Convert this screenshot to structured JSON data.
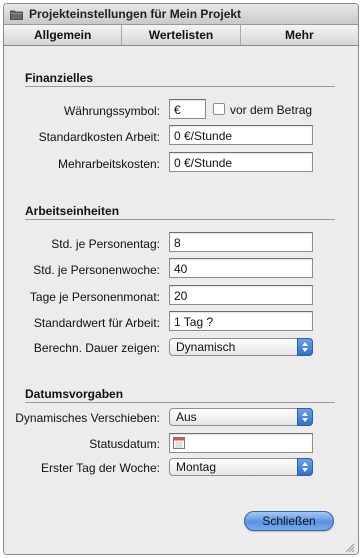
{
  "window": {
    "title": "Projekteinstellungen für Mein Projekt",
    "icon": "folder-icon"
  },
  "tabs": [
    {
      "label": "Allgemein",
      "selected": true
    },
    {
      "label": "Wertelisten",
      "selected": false
    },
    {
      "label": "Mehr",
      "selected": false
    }
  ],
  "finanzielles": {
    "heading": "Finanzielles",
    "currency_label": "Währungssymbol:",
    "currency_value": "€",
    "before_amount_label": "vor dem Betrag",
    "before_amount_checked": false,
    "standard_cost_label": "Standardkosten Arbeit:",
    "standard_cost_value": "0 €/Stunde",
    "overtime_label": "Mehrarbeitskosten:",
    "overtime_value": "0 €/Stunde"
  },
  "arbeitseinheiten": {
    "heading": "Arbeitseinheiten",
    "hours_per_day_label": "Std. je Personentag:",
    "hours_per_day_value": "8",
    "hours_per_week_label": "Std. je Personenwoche:",
    "hours_per_week_value": "40",
    "days_per_month_label": "Tage je Personenmonat:",
    "days_per_month_value": "20",
    "default_work_label": "Standardwert für Arbeit:",
    "default_work_value": "1 Tag ?",
    "duration_label": "Berechn. Dauer zeigen:",
    "duration_value": "Dynamisch"
  },
  "datumsvorgaben": {
    "heading": "Datumsvorgaben",
    "dynamic_shift_label": "Dynamisches Verschieben:",
    "dynamic_shift_value": "Aus",
    "status_date_label": "Statusdatum:",
    "status_date_value": "",
    "first_day_label": "Erster Tag der Woche:",
    "first_day_value": "Montag"
  },
  "footer": {
    "close_label": "Schließen"
  },
  "colors": {
    "accent": "#3b78dc",
    "window_bg": "#ececec"
  }
}
